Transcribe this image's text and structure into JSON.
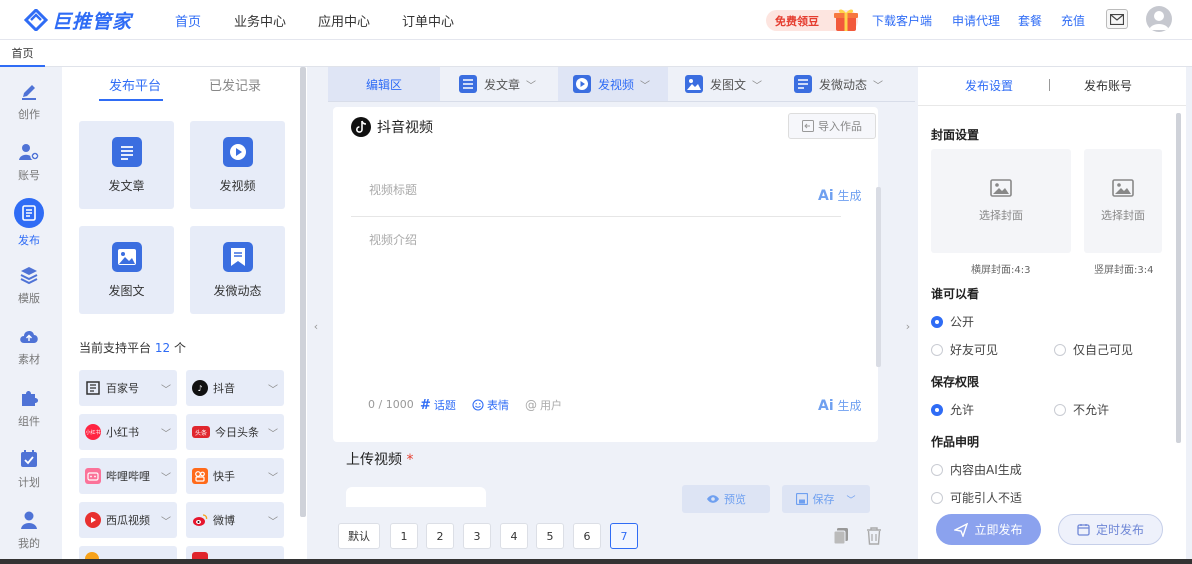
{
  "app": {
    "name": "巨推管家"
  },
  "topnav": [
    {
      "label": "首页",
      "active": true
    },
    {
      "label": "业务中心",
      "active": false
    },
    {
      "label": "应用中心",
      "active": false
    },
    {
      "label": "订单中心",
      "active": false
    }
  ],
  "promo": {
    "label": "免费领豆"
  },
  "toplinks": [
    "下载客户端",
    "申请代理",
    "套餐",
    "充值"
  ],
  "tabstrip": {
    "home_tab": "首页"
  },
  "rail": [
    {
      "label": "创作",
      "icon": "pen-icon"
    },
    {
      "label": "账号",
      "icon": "user-add-icon"
    },
    {
      "label": "发布",
      "icon": "publish-icon",
      "active": true
    },
    {
      "label": "模版",
      "icon": "layers-icon"
    },
    {
      "label": "素材",
      "icon": "cloud-icon"
    },
    {
      "label": "组件",
      "icon": "puzzle-icon"
    },
    {
      "label": "计划",
      "icon": "calendar-check-icon"
    },
    {
      "label": "我的",
      "icon": "person-icon"
    }
  ],
  "platform_panel": {
    "tabs": [
      "发布平台",
      "已发记录"
    ],
    "cards": [
      {
        "label": "发文章",
        "icon": "article-icon"
      },
      {
        "label": "发视频",
        "icon": "video-icon"
      },
      {
        "label": "发图文",
        "icon": "image-icon"
      },
      {
        "label": "发微动态",
        "icon": "bookmark-icon"
      }
    ],
    "support_prefix": "当前支持平台",
    "support_count": "12",
    "support_suffix": "个",
    "platforms": [
      {
        "label": "百家号",
        "color": "#333333"
      },
      {
        "label": "抖音",
        "color": "#111111"
      },
      {
        "label": "小红书",
        "color": "#ff2442"
      },
      {
        "label": "今日头条",
        "color": "#e0262e"
      },
      {
        "label": "哔哩哔哩",
        "color": "#fb7299"
      },
      {
        "label": "快手",
        "color": "#ff6a1a"
      },
      {
        "label": "西瓜视频",
        "color": "#e8302f"
      },
      {
        "label": "微博",
        "color": "#e6162d"
      }
    ],
    "platform_badges": {
      "xhs": "小红书",
      "toutiao": "头条"
    }
  },
  "editor": {
    "tabs": [
      {
        "label": "编辑区"
      },
      {
        "label": "发文章"
      },
      {
        "label": "发视频",
        "active": true
      },
      {
        "label": "发图文"
      },
      {
        "label": "发微动态"
      }
    ],
    "platform_title": "抖音视频",
    "import_label": "导入作品",
    "title_placeholder": "视频标题",
    "ai_label": "生成",
    "intro_placeholder": "视频介绍",
    "counter": "0 / 1000",
    "tools": [
      "话题",
      "表情",
      "用户"
    ],
    "upload_label": "上传视频",
    "preview_label": "预览",
    "save_label": "保存",
    "pages": [
      "默认",
      "1",
      "2",
      "3",
      "4",
      "5",
      "6",
      "7"
    ],
    "active_page": "7"
  },
  "settings": {
    "tabs": [
      "发布设置",
      "发布账号"
    ],
    "cover_title": "封面设置",
    "cover_pick": "选择封面",
    "cover_captions": [
      "横屏封面:4:3",
      "竖屏封面:3:4"
    ],
    "visibility_title": "谁可以看",
    "visibility_options": [
      "公开",
      "好友可见",
      "仅自己可见"
    ],
    "save_perm_title": "保存权限",
    "save_perm_options": [
      "允许",
      "不允许"
    ],
    "declare_title": "作品申明",
    "declare_options": [
      "内容由AI生成",
      "可能引人不适"
    ],
    "publish_now": "立即发布",
    "publish_scheduled": "定时发布"
  },
  "colors": {
    "accent": "#2f6cf5",
    "danger": "#e53d2f"
  }
}
